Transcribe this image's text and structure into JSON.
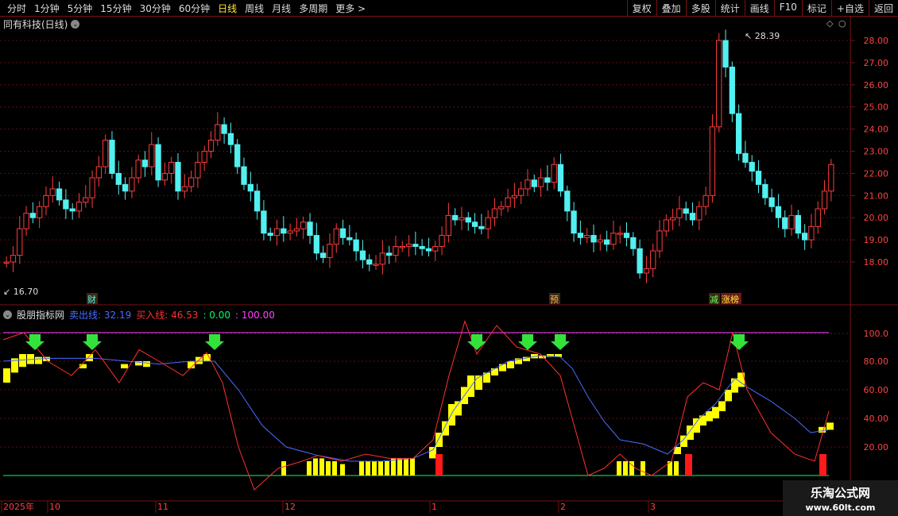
{
  "toolbar": {
    "periods": [
      "分时",
      "1分钟",
      "5分钟",
      "15分钟",
      "30分钟",
      "60分钟",
      "日线",
      "周线",
      "月线",
      "多周期",
      "更多 >"
    ],
    "active_period": "日线",
    "actions": [
      "复权",
      "叠加",
      "多股",
      "统计",
      "画线",
      "F10",
      "标记",
      "+自选",
      "返回"
    ]
  },
  "stock": {
    "title": "同有科技(日线)"
  },
  "indicator": {
    "name": "股朋指标网",
    "sell_label": "卖出线: 32.19",
    "buy_label": "买入线: 46.53",
    "zero_label": ": 0.00",
    "hundred_label": ": 100.00",
    "colors": {
      "sell": "#4a6cff",
      "buy": "#ff3030",
      "zero": "#00ff66",
      "hundred": "#ff40ff"
    }
  },
  "price_labels": {
    "high": "28.39",
    "low": "16.70"
  },
  "event_tags": [
    "财",
    "预",
    "减",
    "涨榜"
  ],
  "x_axis": [
    "2025年",
    "10",
    "11",
    "12",
    "1",
    "2",
    "3"
  ],
  "watermark": {
    "line1": "乐淘公式网",
    "line2": "www.60lt.com"
  },
  "chart_data": [
    {
      "type": "candlestick",
      "y_ticks": [
        "28.00",
        "27.00",
        "26.00",
        "25.00",
        "24.00",
        "23.00",
        "22.00",
        "21.00",
        "20.00",
        "19.00",
        "18.00"
      ],
      "ylim": [
        16.7,
        28.39
      ]
    },
    {
      "type": "line",
      "y_ticks": [
        "100.0",
        "80.00",
        "60.00",
        "40.00",
        "20.00"
      ],
      "ylim": [
        0,
        100
      ],
      "series": [
        {
          "name": "卖出线"
        },
        {
          "name": "买入线"
        }
      ]
    }
  ]
}
